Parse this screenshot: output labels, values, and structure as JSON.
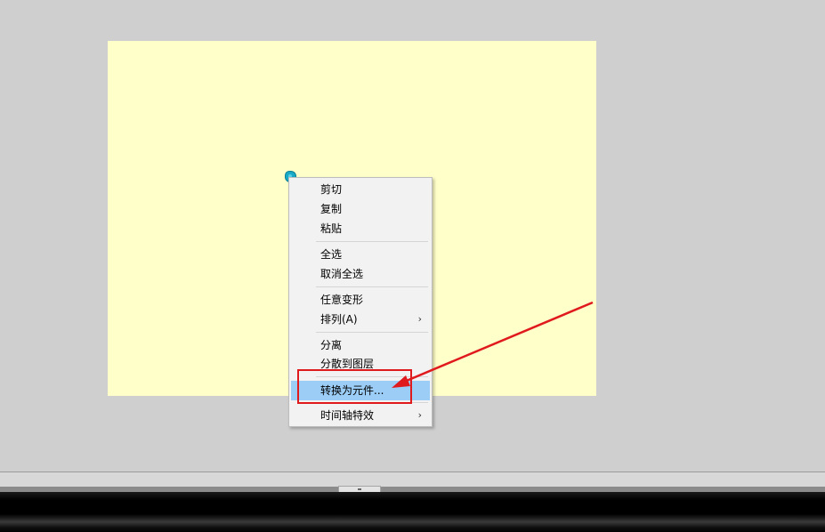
{
  "context_menu": {
    "items": [
      {
        "label": "剪切"
      },
      {
        "label": "复制"
      },
      {
        "label": "粘贴"
      },
      {
        "label": "全选"
      },
      {
        "label": "取消全选"
      },
      {
        "label": "任意变形"
      },
      {
        "label": "排列(A)",
        "submenu_arrow": "›"
      },
      {
        "label": "分离"
      },
      {
        "label": "分散到图层"
      },
      {
        "label": "转换为元件...",
        "highlighted": true
      },
      {
        "label": "时间轴特效",
        "submenu_arrow": "›"
      }
    ]
  },
  "colors": {
    "stage_background": "#ffffc9",
    "workspace_background": "#cfcfcf",
    "menu_highlight": "#9bcdf7",
    "annotation_red": "#e0191d"
  },
  "icons": {
    "selected_shape": "cyan-shape-icon",
    "submenu": "chevron-right-icon"
  }
}
